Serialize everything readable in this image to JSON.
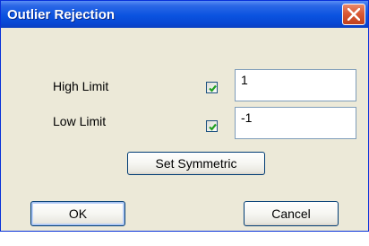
{
  "window": {
    "title": "Outlier Rejection",
    "close_icon": "close-x-icon"
  },
  "high_limit": {
    "label": "High Limit",
    "checked": true,
    "value": "1"
  },
  "low_limit": {
    "label": "Low Limit",
    "checked": true,
    "value": "-1"
  },
  "buttons": {
    "set_symmetric": "Set Symmetric",
    "ok": "OK",
    "cancel": "Cancel"
  },
  "colors": {
    "titlebar": "#0a53e0",
    "close_button": "#d95a36",
    "dialog_background": "#ece9d8",
    "check_mark": "#21a121"
  }
}
